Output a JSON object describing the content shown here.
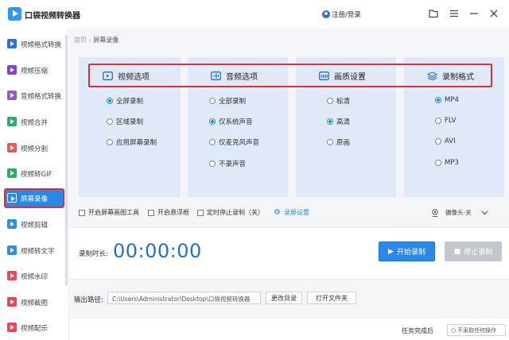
{
  "app": {
    "title": "口袋视频转换器",
    "user_label": "注册/登录"
  },
  "sidebar": {
    "items": [
      {
        "label": "视频格式转换",
        "color": "#2d6fe0"
      },
      {
        "label": "视频压缩",
        "color": "#7c45d6"
      },
      {
        "label": "音频格式转换",
        "color": "#9b59d0"
      },
      {
        "label": "视频合并",
        "color": "#2eaa6a"
      },
      {
        "label": "视频分割",
        "color": "#e65a5a"
      },
      {
        "label": "视频转GIF",
        "color": "#2eaa6a"
      },
      {
        "label": "屏幕录像",
        "color": "#ffffff"
      },
      {
        "label": "视频剪辑",
        "color": "#2d8fe0"
      },
      {
        "label": "视频转文字",
        "color": "#2d8fe0"
      },
      {
        "label": "视频水印",
        "color": "#e64a5a"
      },
      {
        "label": "视频截图",
        "color": "#e6484f"
      },
      {
        "label": "视频配乐",
        "color": "#e64a5a"
      }
    ]
  },
  "breadcrumb": {
    "home": "首页",
    "sep": "›",
    "current": "屏幕录像"
  },
  "panels": {
    "video": {
      "title": "视频选项",
      "options": [
        "全屏录制",
        "区域录制",
        "应用屏幕录制"
      ],
      "selected": 0
    },
    "audio": {
      "title": "音频选项",
      "options": [
        "全部录制",
        "仅系统声音",
        "仅麦克风声音",
        "不录声音"
      ],
      "selected": 1
    },
    "quality": {
      "title": "画质设置",
      "options": [
        "标清",
        "高清",
        "原画"
      ],
      "selected": 1
    },
    "format": {
      "title": "录制格式",
      "options": [
        "MP4",
        "FLV",
        "AVI",
        "MP3"
      ],
      "selected": 0
    }
  },
  "checks": {
    "toolbar": "开启屏幕画图工具",
    "float": "开启悬浮框",
    "timer_stop": "定时停止录制（关）",
    "settings": "录屏设置",
    "camera": "摄像头-关"
  },
  "record": {
    "label": "录制时长:",
    "time": "00:00:00",
    "start": "开始录制",
    "stop": "停止录制"
  },
  "output": {
    "label": "输出路径:",
    "path": "C:\\Users\\Administrator\\Desktop\\口袋视频转换器",
    "change_dir": "更改目录",
    "open_folder": "打开文件夹"
  },
  "footer": {
    "done_label": "任务完成后",
    "done_option": "不采取任何操作"
  },
  "colors": {
    "accent": "#2a89e8",
    "highlight_box": "#d9303a",
    "panel": "#dfe9f7"
  }
}
